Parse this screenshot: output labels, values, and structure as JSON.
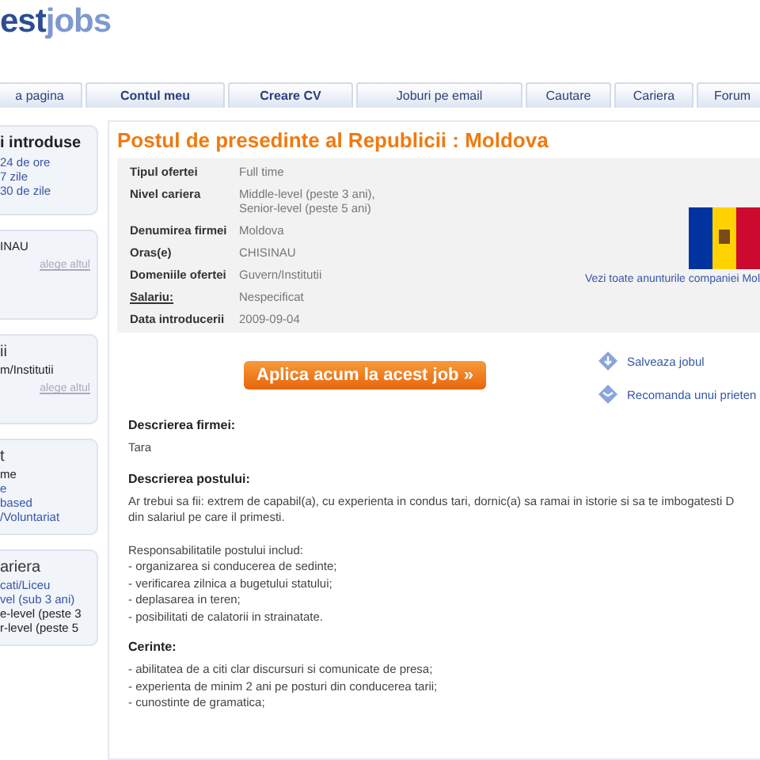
{
  "logo": {
    "dark": "est",
    "light": "jobs"
  },
  "tabs": [
    {
      "label": "a pagina",
      "bold": false
    },
    {
      "label": "Contul meu",
      "bold": true
    },
    {
      "label": "Creare CV",
      "bold": true
    },
    {
      "label": "Joburi pe email",
      "bold": false
    },
    {
      "label": "Cautare",
      "bold": false
    },
    {
      "label": "Cariera",
      "bold": false
    },
    {
      "label": "Forum",
      "bold": false
    }
  ],
  "sidebar": [
    {
      "title": "i introduse",
      "items": [
        {
          "text": "24 de ore",
          "link": true
        },
        {
          "text": "7 zile",
          "link": true
        },
        {
          "text": "30 de zile",
          "link": true
        }
      ]
    },
    {
      "items": [
        {
          "text": "INAU",
          "link": false
        }
      ],
      "change": "alege altul"
    },
    {
      "title": "ii",
      "items": [
        {
          "text": "m/Institutii",
          "link": false
        }
      ],
      "change": "alege altul"
    },
    {
      "title": "t",
      "items": [
        {
          "text": "me",
          "link": false
        },
        {
          "text": "e",
          "link": true
        },
        {
          "text": "based",
          "link": true
        },
        {
          "text": "/Voluntariat",
          "link": true
        }
      ]
    },
    {
      "title": "ariera",
      "items": [
        {
          "text": "cati/Liceu",
          "link": true
        },
        {
          "text": "vel (sub 3 ani)",
          "link": true
        },
        {
          "text": "e-level (peste 3",
          "link": false
        },
        {
          "text": "r-level (peste 5",
          "link": false
        }
      ]
    }
  ],
  "job": {
    "title": "Postul de presedinte al Republicii : Moldova",
    "details": [
      {
        "label": "Tipul ofertei",
        "value": "Full time",
        "underline": false
      },
      {
        "label": "Nivel cariera",
        "value": "Middle-level (peste 3 ani),\nSenior-level (peste 5 ani)",
        "underline": false
      },
      {
        "label": "Denumirea firmei",
        "value": "Moldova",
        "underline": false
      },
      {
        "label": "Oras(e)",
        "value": "CHISINAU",
        "underline": false
      },
      {
        "label": "Domeniile ofertei",
        "value": "Guvern/Institutii",
        "underline": false
      },
      {
        "label": "Salariu:",
        "value": "Nespecificat",
        "underline": true
      },
      {
        "label": "Data introducerii",
        "value": "2009-09-04",
        "underline": false
      }
    ],
    "company_link": "Vezi toate anunturile companiei Mol",
    "apply": "Aplica acum la acest job »",
    "actions": [
      "Salveaza jobul",
      "Recomanda unui prieten"
    ],
    "sections": [
      {
        "heading": "Descrierea firmei:",
        "lines": [
          "Tara"
        ]
      },
      {
        "heading": "Descrierea postului:",
        "lines": [
          "Ar trebui sa fii: extrem de capabil(a), cu experienta in condus tari, dornic(a) sa ramai in istorie si sa te imbogatesti D",
          "din salariul pe care il primesti."
        ],
        "more_lines": [
          "Responsabilitatile postului includ:",
          "- organizarea si conducerea de sedinte;",
          "- verificarea zilnica a bugetului statului;",
          "- deplasarea in teren;",
          "- posibilitati de calatorii in strainatate."
        ]
      },
      {
        "heading": "Cerinte:",
        "lines": [
          "- abilitatea de a citi clar discursuri si comunicate de presa;",
          "- experienta de minim 2 ani pe posturi din conducerea tarii;",
          "- cunostinte de gramatica;"
        ]
      }
    ]
  }
}
